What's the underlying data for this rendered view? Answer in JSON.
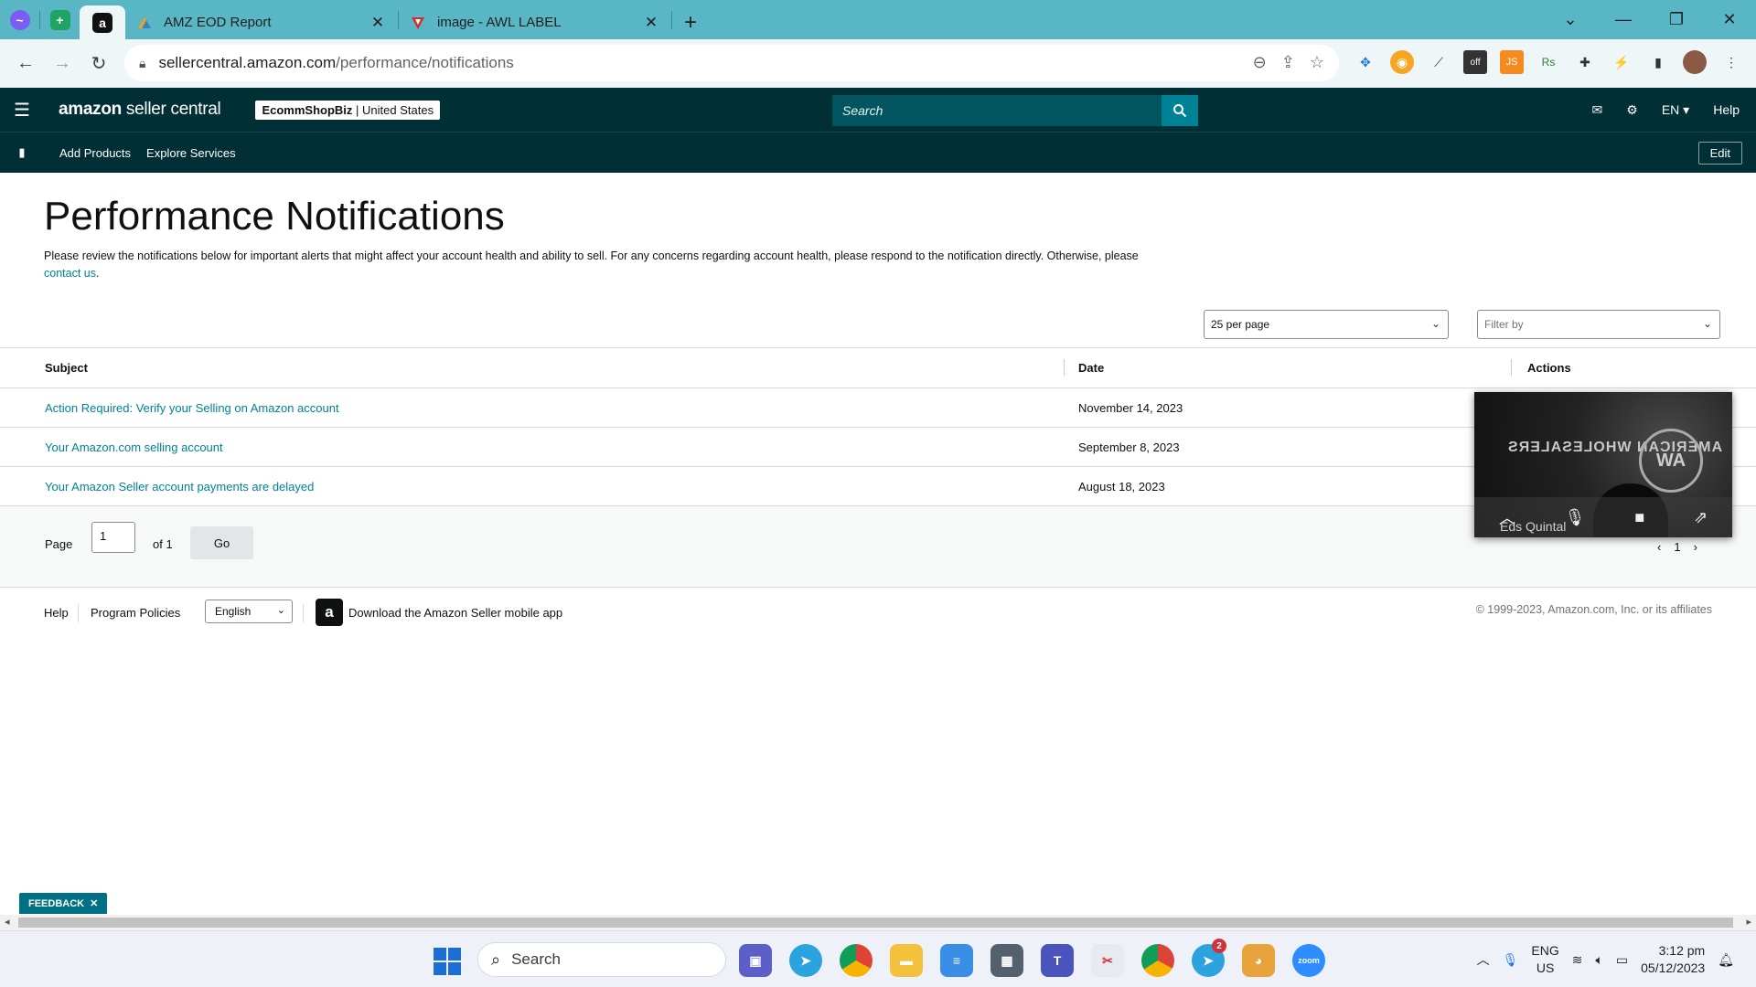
{
  "browser": {
    "tabs": [
      {
        "title": "AMZ EOD Report",
        "icon": "amz-eod-favicon"
      },
      {
        "title": "image - AWL LABEL",
        "icon": "awl-favicon"
      }
    ],
    "url_host": "sellercentral.amazon.com",
    "url_path": "/performance/notifications"
  },
  "header": {
    "logo_brand": "amazon",
    "logo_product": " seller central",
    "store_name": "EcommShopBiz",
    "store_region": " | United States",
    "search_placeholder": "Search",
    "language": "EN",
    "help": "Help"
  },
  "nav": {
    "items": [
      "Add Products",
      "Explore Services"
    ],
    "edit": "Edit"
  },
  "page": {
    "title": "Performance Notifications",
    "intro": "Please review the notifications below for important alerts that might affect your account health and ability to sell. For any concerns regarding account health, please respond to the notification directly. Otherwise, please ",
    "intro_link": "contact us",
    "intro_end": "."
  },
  "controls": {
    "per_page": "25 per page",
    "filter_placeholder": "Filter by"
  },
  "table": {
    "headers": {
      "subject": "Subject",
      "date": "Date",
      "actions": "Actions"
    },
    "rows": [
      {
        "subject": "Action Required: Verify your Selling on Amazon account",
        "date": "November 14, 2023"
      },
      {
        "subject": "Your Amazon.com selling account",
        "date": "September 8, 2023"
      },
      {
        "subject": "Your Amazon Seller account payments are delayed",
        "date": "August 18, 2023"
      }
    ]
  },
  "pager": {
    "page_label": "Page",
    "page_value": "1",
    "of_label": "of 1",
    "go": "Go",
    "mini_current": "1"
  },
  "footer": {
    "help": "Help",
    "policies": "Program Policies",
    "language": "English",
    "app": "Download the Amazon Seller mobile app",
    "copyright": "© 1999-2023, Amazon.com, Inc. or its affiliates"
  },
  "video": {
    "watermark": "AMERICAN WHOLESALERS",
    "participant": "Eds Quintal"
  },
  "feedback": "FEEDBACK",
  "taskbar": {
    "search": "Search",
    "lang_top": "ENG",
    "lang_bottom": "US",
    "time": "3:12 pm",
    "date": "05/12/2023",
    "telegram_badge": "2"
  },
  "colors": {
    "header_bg": "#002f36",
    "link": "#008296",
    "tabbar": "#59b6c5"
  }
}
